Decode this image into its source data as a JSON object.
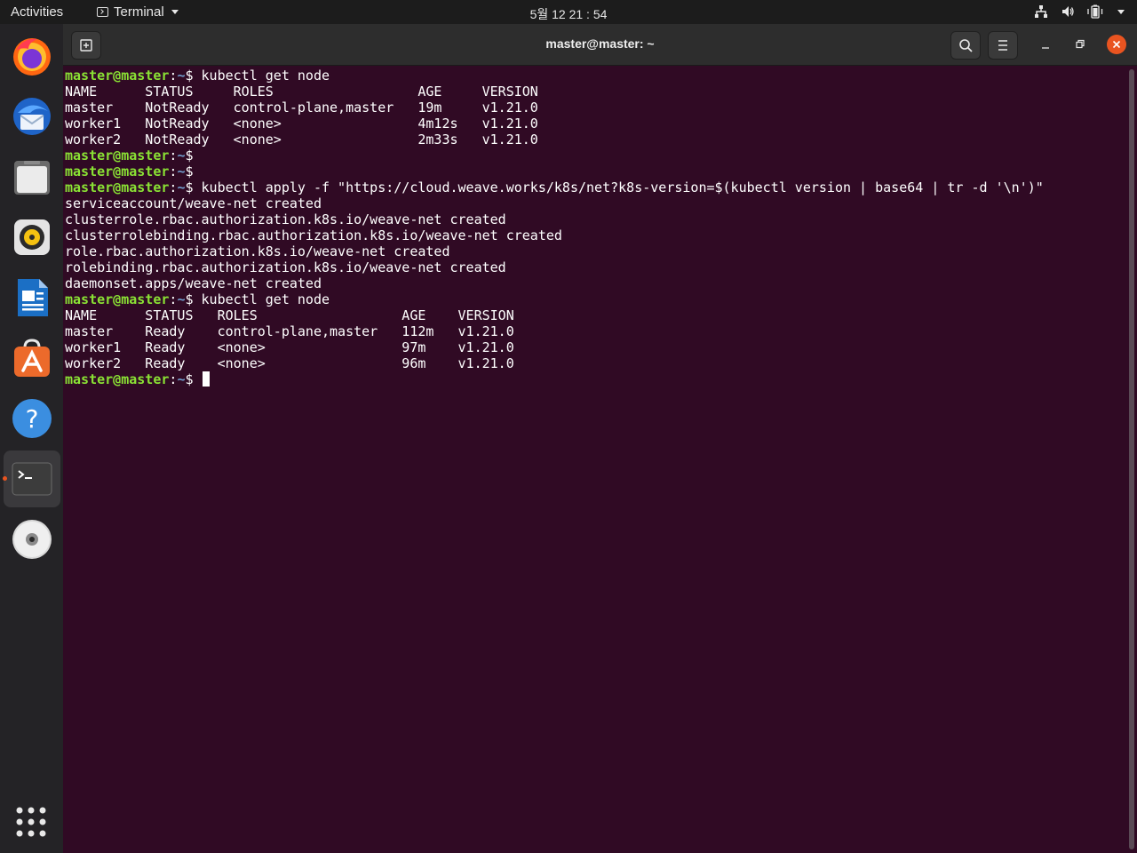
{
  "topbar": {
    "activities": "Activities",
    "app_name": "Terminal",
    "clock": "5월 12  21 : 54"
  },
  "dock": {
    "items": [
      {
        "name": "firefox"
      },
      {
        "name": "thunderbird"
      },
      {
        "name": "files"
      },
      {
        "name": "rhythmbox"
      },
      {
        "name": "libreoffice-writer"
      },
      {
        "name": "ubuntu-software"
      },
      {
        "name": "help"
      },
      {
        "name": "terminal",
        "active": true
      },
      {
        "name": "dvd-drive"
      }
    ]
  },
  "window": {
    "title": "master@master: ~"
  },
  "terminal": {
    "prompt": {
      "user": "master@master",
      "path": "~",
      "symbol": "$"
    },
    "lines": [
      {
        "type": "prompt",
        "cmd": " kubectl get node"
      },
      {
        "type": "out",
        "text": "NAME      STATUS     ROLES                  AGE     VERSION"
      },
      {
        "type": "out",
        "text": "master    NotReady   control-plane,master   19m     v1.21.0"
      },
      {
        "type": "out",
        "text": "worker1   NotReady   <none>                 4m12s   v1.21.0"
      },
      {
        "type": "out",
        "text": "worker2   NotReady   <none>                 2m33s   v1.21.0"
      },
      {
        "type": "prompt",
        "cmd": ""
      },
      {
        "type": "prompt",
        "cmd": ""
      },
      {
        "type": "prompt",
        "cmd": " kubectl apply -f \"https://cloud.weave.works/k8s/net?k8s-version=$(kubectl version | base64 | tr -d '\\n')\""
      },
      {
        "type": "out",
        "text": "serviceaccount/weave-net created"
      },
      {
        "type": "out",
        "text": "clusterrole.rbac.authorization.k8s.io/weave-net created"
      },
      {
        "type": "out",
        "text": "clusterrolebinding.rbac.authorization.k8s.io/weave-net created"
      },
      {
        "type": "out",
        "text": "role.rbac.authorization.k8s.io/weave-net created"
      },
      {
        "type": "out",
        "text": "rolebinding.rbac.authorization.k8s.io/weave-net created"
      },
      {
        "type": "out",
        "text": "daemonset.apps/weave-net created"
      },
      {
        "type": "prompt",
        "cmd": " kubectl get node"
      },
      {
        "type": "out",
        "text": "NAME      STATUS   ROLES                  AGE    VERSION"
      },
      {
        "type": "out",
        "text": "master    Ready    control-plane,master   112m   v1.21.0"
      },
      {
        "type": "out",
        "text": "worker1   Ready    <none>                 97m    v1.21.0"
      },
      {
        "type": "out",
        "text": "worker2   Ready    <none>                 96m    v1.21.0"
      },
      {
        "type": "prompt",
        "cmd": " ",
        "cursor": true
      }
    ]
  },
  "colors": {
    "terminal_bg": "#300a24",
    "prompt_user": "#8ae234",
    "prompt_path": "#729fcf",
    "accent": "#e95420"
  }
}
